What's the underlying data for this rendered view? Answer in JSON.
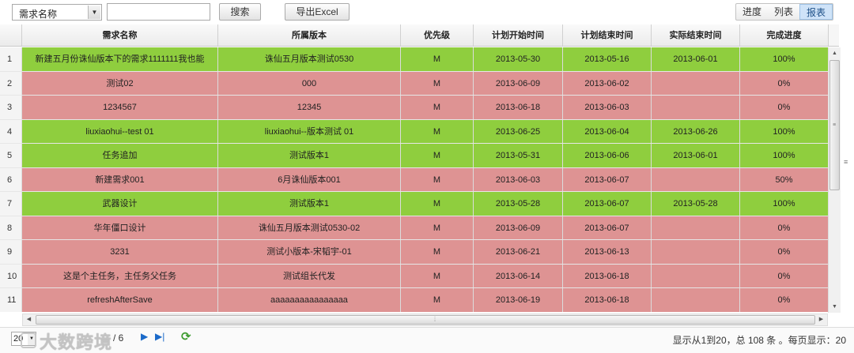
{
  "toolbar": {
    "field_select": "需求名称",
    "search_value": "",
    "search_label": "搜索",
    "export_label": "导出Excel",
    "views": [
      "进度",
      "列表",
      "报表"
    ],
    "active_view": "报表"
  },
  "grid": {
    "columns": [
      "需求名称",
      "所属版本",
      "优先级",
      "计划开始时间",
      "计划结束时间",
      "实际结束时间",
      "完成进度"
    ],
    "colors": {
      "done": "#8fce3e",
      "overdue": "#de9393"
    },
    "rows": [
      {
        "n": "1",
        "name": "新建五月份诛仙版本下的需求1111111我也能",
        "version": "诛仙五月版本测试0530",
        "priority": "M",
        "plan_start": "2013-05-30",
        "plan_end": "2013-05-16",
        "actual_end": "2013-06-01",
        "progress": "100%",
        "status": "green"
      },
      {
        "n": "2",
        "name": "测试02",
        "version": "000",
        "priority": "M",
        "plan_start": "2013-06-09",
        "plan_end": "2013-06-02",
        "actual_end": "",
        "progress": "0%",
        "status": "red"
      },
      {
        "n": "3",
        "name": "1234567",
        "version": "12345",
        "priority": "M",
        "plan_start": "2013-06-18",
        "plan_end": "2013-06-03",
        "actual_end": "",
        "progress": "0%",
        "status": "red"
      },
      {
        "n": "4",
        "name": "liuxiaohui--test 01",
        "version": "liuxiaohui--版本测试 01",
        "priority": "M",
        "plan_start": "2013-06-25",
        "plan_end": "2013-06-04",
        "actual_end": "2013-06-26",
        "progress": "100%",
        "status": "green"
      },
      {
        "n": "5",
        "name": "任务追加",
        "version": "测试版本1",
        "priority": "M",
        "plan_start": "2013-05-31",
        "plan_end": "2013-06-06",
        "actual_end": "2013-06-01",
        "progress": "100%",
        "status": "green"
      },
      {
        "n": "6",
        "name": "新建需求001",
        "version": "6月诛仙版本001",
        "priority": "M",
        "plan_start": "2013-06-03",
        "plan_end": "2013-06-07",
        "actual_end": "",
        "progress": "50%",
        "status": "red"
      },
      {
        "n": "7",
        "name": "武器设计",
        "version": "测试版本1",
        "priority": "M",
        "plan_start": "2013-05-28",
        "plan_end": "2013-06-07",
        "actual_end": "2013-05-28",
        "progress": "100%",
        "status": "green"
      },
      {
        "n": "8",
        "name": "华年僵口设计",
        "version": "诛仙五月版本测试0530-02",
        "priority": "M",
        "plan_start": "2013-06-09",
        "plan_end": "2013-06-07",
        "actual_end": "",
        "progress": "0%",
        "status": "red"
      },
      {
        "n": "9",
        "name": "3231",
        "version": "测试小版本-宋韬宇-01",
        "priority": "M",
        "plan_start": "2013-06-21",
        "plan_end": "2013-06-13",
        "actual_end": "",
        "progress": "0%",
        "status": "red"
      },
      {
        "n": "10",
        "name": "这是个主任务，主任务父任务",
        "version": "测试组长代发",
        "priority": "M",
        "plan_start": "2013-06-14",
        "plan_end": "2013-06-18",
        "actual_end": "",
        "progress": "0%",
        "status": "red"
      },
      {
        "n": "11",
        "name": "refreshAfterSave",
        "version": "aaaaaaaaaaaaaaaa",
        "priority": "M",
        "plan_start": "2013-06-19",
        "plan_end": "2013-06-18",
        "actual_end": "",
        "progress": "0%",
        "status": "red"
      }
    ]
  },
  "pager": {
    "page_size": "20",
    "page_of": "/ 6",
    "info": "显示从1到20，总 108 条 。每页显示：20",
    "watermark": "大数跨境"
  }
}
